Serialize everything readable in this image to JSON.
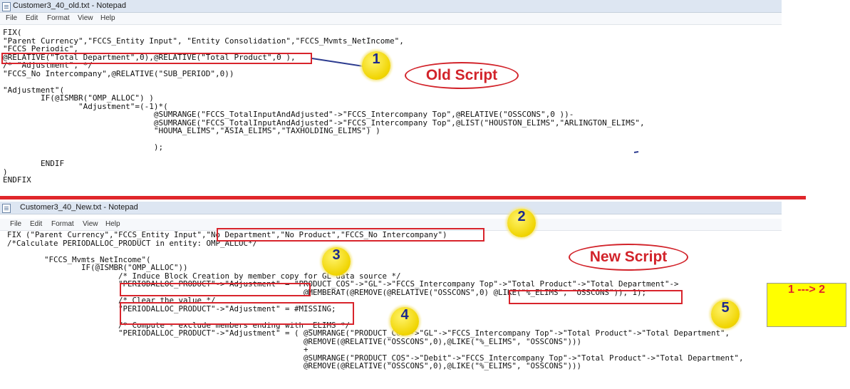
{
  "old_window": {
    "title": "Customer3_40_old.txt - Notepad",
    "menu": [
      "File",
      "Edit",
      "Format",
      "View",
      "Help"
    ],
    "code": "FIX(\n\"Parent Currency\",\"FCCS_Entity Input\", \"Entity Consolidation\",\"FCCS_Mvmts_NetIncome\",\n\"FCCS_Periodic\",\n@RELATIVE(\"Total Department\",0),@RELATIVE(\"Total Product\",0 ),\n/* \"Adjustment\", */\n\"FCCS_No Intercompany\",@RELATIVE(\"SUB_PERIOD\",0))\n\n\"Adjustment\"(\n        IF(@ISMBR(\"OMP_ALLOC\") )\n                \"Adjustment\"=(-1)*(\n                                @SUMRANGE(\"FCCS_TotalInputAndAdjusted\"->\"FCCS_Intercompany Top\",@RELATIVE(\"OSSCONS\",0 ))-\n                                @SUMRANGE(\"FCCS_TotalInputAndAdjusted\"->\"FCCS_Intercompany Top\",@LIST(\"HOUSTON_ELIMS\",\"ARLINGTON_ELIMS\",\n                                \"HOUMA_ELIMS\",\"ASIA_ELIMS\",\"TAXHOLDING_ELIMS\") )\n\n                                );\n\n        ENDIF\n)\nENDFIX"
  },
  "new_window": {
    "title": "Customer3_40_New.txt - Notepad",
    "menu": [
      "File",
      "Edit",
      "Format",
      "View",
      "Help"
    ],
    "code": "FIX (\"Parent Currency\",\"FCCS_Entity Input\",\"No Department\",\"No Product\",\"FCCS_No Intercompany\")\n/*Calculate PERIODALLOC_PRODUCT in entity: OMP_ALLOC*/\n\n        \"FCCS_Mvmts_NetIncome\"(\n                IF(@ISMBR(\"OMP_ALLOC\"))\n                        /* Induce Block Creation by member copy for GL data source */\n                        \"PERIODALLOC_PRODUCT\"->\"Adjustment\" = \"PRODUCT_COS\"->\"GL\"->\"FCCS_Intercompany Top\"->\"Total Product\"->\"Total Department\"->\n                                                                @MEMBERAT(@REMOVE(@RELATIVE(\"OSSCONS\",0) @LIKE(\"%_ELIMS\", \"OSSCONS\")), 1);\n                        /* Clear the value */\n                        \"PERIODALLOC_PRODUCT\"->\"Adjustment\" = #MISSING;\n\n                        /* Compute - exclude members ending with _ELIMS */\n                        \"PERIODALLOC_PRODUCT\"->\"Adjustment\" = ( @SUMRANGE(\"PRODUCT_COS\"->\"GL\"->\"FCCS_Intercompany Top\"->\"Total Product\"->\"Total Department\",\n                                                                @REMOVE(@RELATIVE(\"OSSCONS\",0),@LIKE(\"%_ELIMS\", \"OSSCONS\")))\n                                                                +\n                                                                @SUMRANGE(\"PRODUCT_COS\"->\"Debit\"->\"FCCS_Intercompany Top\"->\"Total Product\"->\"Total Department\",\n                                                                @REMOVE(@RELATIVE(\"OSSCONS\",0),@LIKE(\"%_ELIMS\", \"OSSCONS\")))"
  },
  "annotations": {
    "old_label": "Old Script",
    "new_label": "New Script",
    "markers": [
      "1",
      "2",
      "3",
      "4",
      "5"
    ],
    "callout": "1 ---> 2"
  },
  "colors": {
    "annotation_red": "#d8242c",
    "marker_yellow": "#f0d400",
    "marker_text": "#1d2a8c",
    "divider": "#e0262b",
    "callout_bg": "#ffff00"
  }
}
